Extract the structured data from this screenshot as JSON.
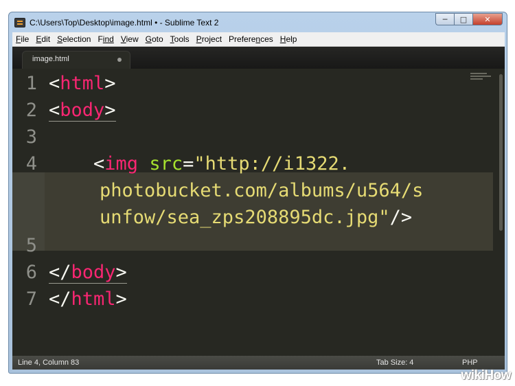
{
  "window": {
    "title": "C:\\Users\\Top\\Desktop\\image.html • - Sublime Text 2",
    "buttons": {
      "minimize": "─",
      "maximize": "□",
      "close": "✕"
    }
  },
  "menubar": {
    "items": [
      {
        "u": "F",
        "rest": "ile"
      },
      {
        "u": "E",
        "rest": "dit"
      },
      {
        "u": "S",
        "rest": "election"
      },
      {
        "u": "F",
        "rest": "ind",
        "pre": ""
      },
      {
        "u": "V",
        "rest": "iew"
      },
      {
        "u": "G",
        "rest": "oto"
      },
      {
        "u": "T",
        "rest": "ools"
      },
      {
        "u": "P",
        "rest": "roject"
      },
      {
        "u": "n",
        "pre": "Prefere",
        "rest": "ces"
      },
      {
        "u": "H",
        "rest": "elp"
      }
    ]
  },
  "tab": {
    "label": "image.html",
    "modified": true
  },
  "gutter": {
    "numbers": [
      "1",
      "2",
      "3",
      "4",
      "5",
      "6",
      "7"
    ]
  },
  "code": {
    "line1": {
      "open": "<",
      "tag": "html",
      "close": ">"
    },
    "line2": {
      "open": "<",
      "tag": "body",
      "close": ">"
    },
    "line4": {
      "indent": "    ",
      "open": "<",
      "tag": "img",
      "attr": "src",
      "eq": "=",
      "value_part1": "\"http://i1322.",
      "value_part2": "photobucket.com/albums/u564/s",
      "value_part3": "unfow/sea_zps208895dc.jpg\"",
      "close": "/>"
    },
    "line6": {
      "open": "</",
      "tag": "body",
      "close": ">"
    },
    "line7": {
      "open": "</",
      "tag": "html",
      "close": ">"
    }
  },
  "statusbar": {
    "position": "Line 4, Column 83",
    "tab_size": "Tab Size: 4",
    "syntax": "PHP"
  },
  "watermark": {
    "text": "wikiHow"
  },
  "colors": {
    "background": "#272822",
    "tag": "#f92672",
    "attribute": "#a6e22e",
    "string": "#e6db74",
    "punctuation": "#f8f8f2",
    "line_number": "#8f908a"
  }
}
